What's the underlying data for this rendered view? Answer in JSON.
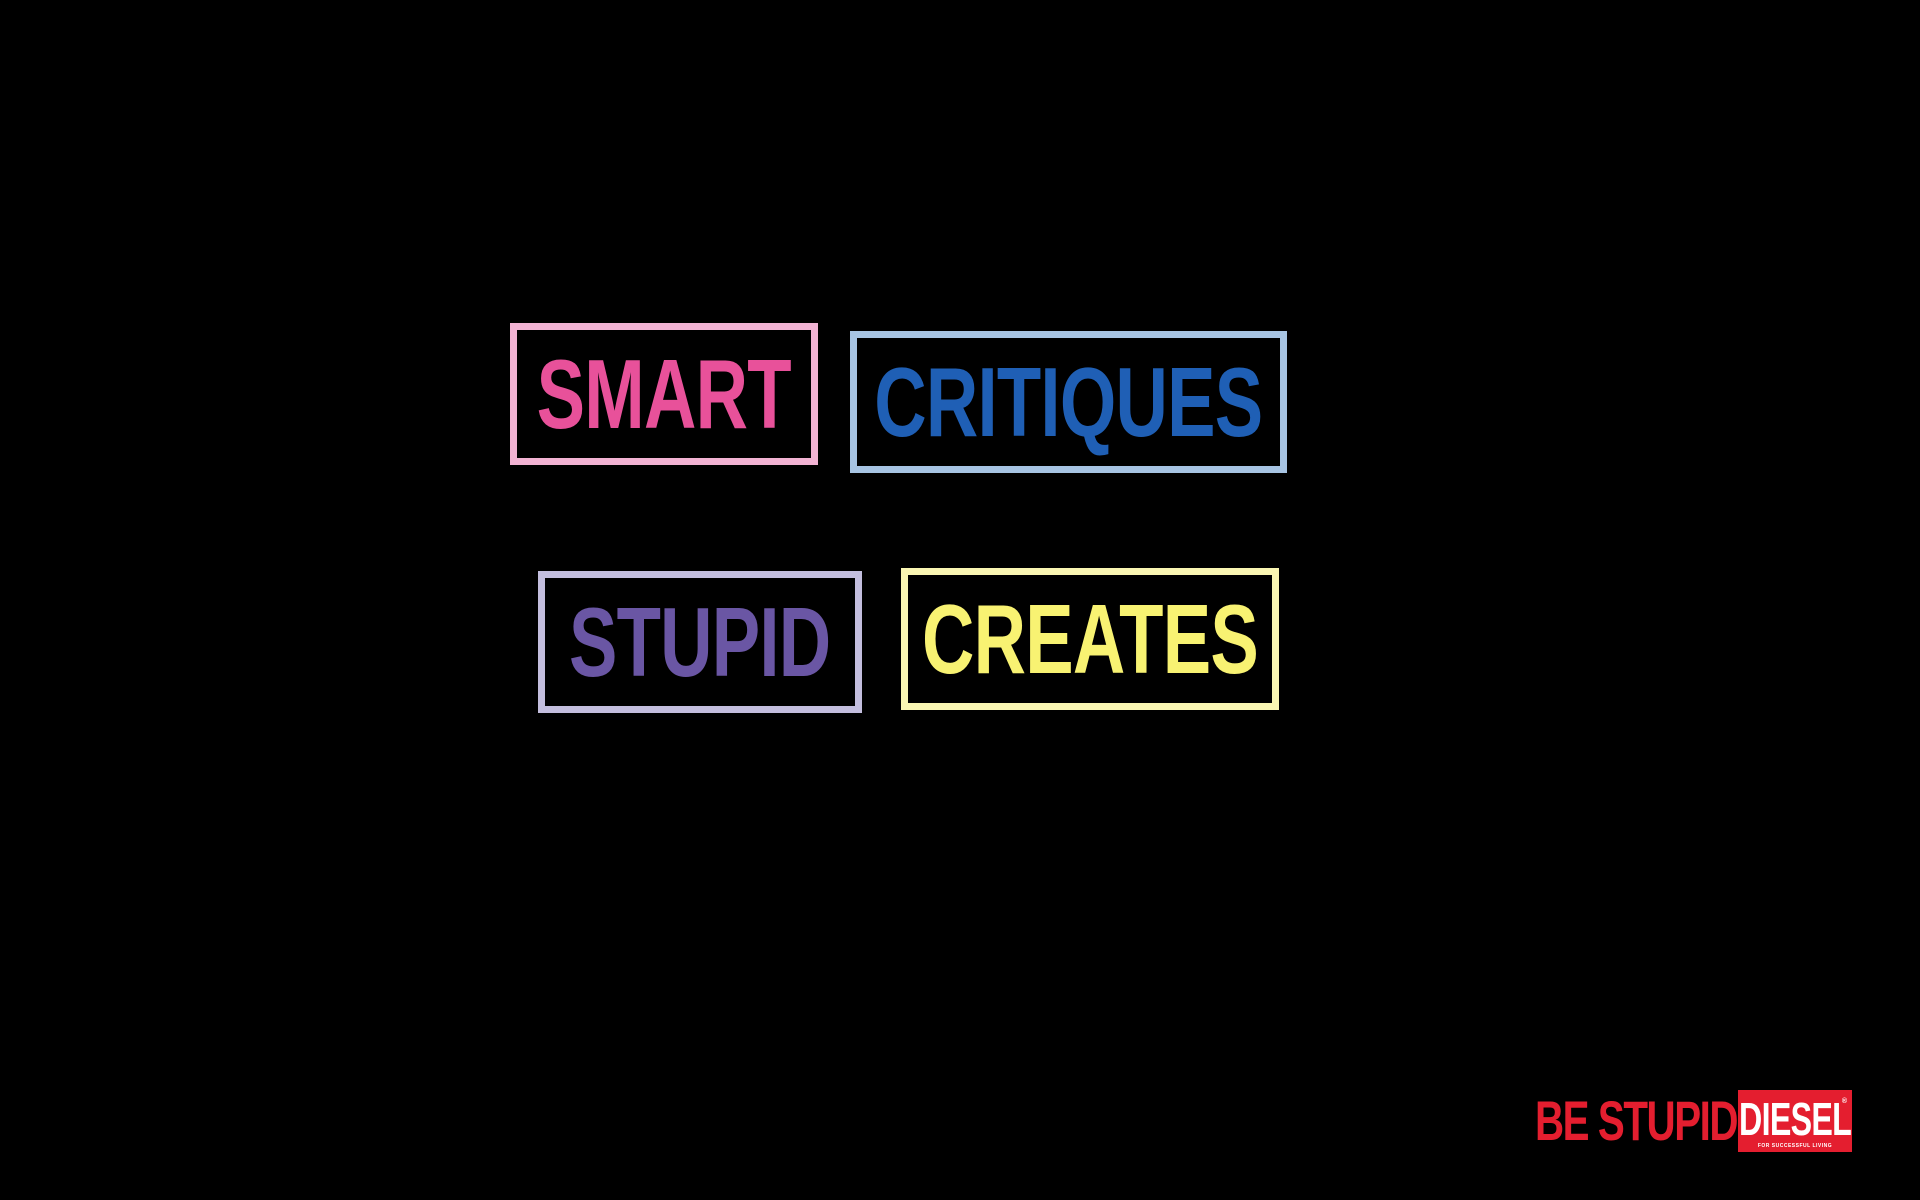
{
  "words": {
    "smart": {
      "text": "SMART",
      "text_color": "#E8519A",
      "border_color": "#F2B3D3"
    },
    "critiques": {
      "text": "CRITIQUES",
      "text_color": "#1F5FB5",
      "border_color": "#A7C4E3"
    },
    "stupid": {
      "text": "STUPID",
      "text_color": "#6A56A4",
      "border_color": "#C3BEDE"
    },
    "creates": {
      "text": "CREATES",
      "text_color": "#F8F272",
      "border_color": "#FAF6B3"
    }
  },
  "brand": {
    "tagline": "BE STUPID",
    "logo_text": "DIESEL",
    "logo_subtext": "FOR SUCCESSFUL LIVING",
    "logo_mark": "®",
    "brand_color": "#E41E2F",
    "logo_text_color": "#FFFFFF"
  },
  "background_color": "#000000"
}
